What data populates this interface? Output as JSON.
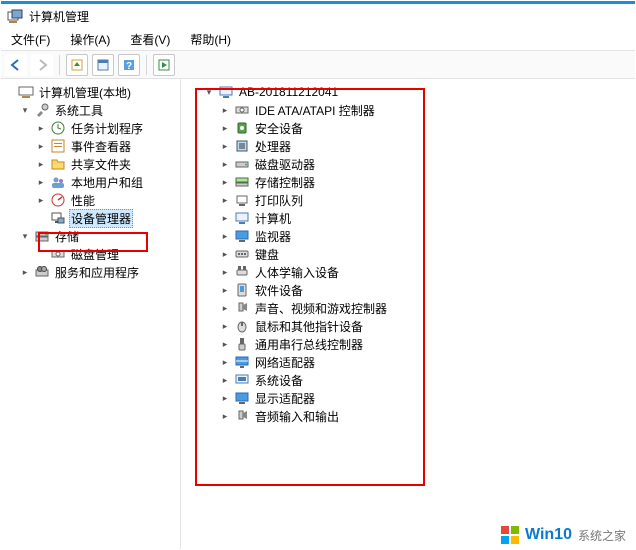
{
  "window": {
    "title": "计算机管理"
  },
  "menu": {
    "file": "文件(F)",
    "action": "操作(A)",
    "view": "查看(V)",
    "help": "帮助(H)"
  },
  "left_tree": {
    "root": "计算机管理(本地)",
    "system_tools": "系统工具",
    "task_scheduler": "任务计划程序",
    "event_viewer": "事件查看器",
    "shared_folders": "共享文件夹",
    "local_users": "本地用户和组",
    "performance": "性能",
    "device_manager": "设备管理器",
    "storage": "存储",
    "disk_management": "磁盘管理",
    "services_apps": "服务和应用程序"
  },
  "right_tree": {
    "computer_name": "AB-201811212041",
    "items": [
      "IDE ATA/ATAPI 控制器",
      "安全设备",
      "处理器",
      "磁盘驱动器",
      "存储控制器",
      "打印队列",
      "计算机",
      "监视器",
      "键盘",
      "人体学输入设备",
      "软件设备",
      "声音、视频和游戏控制器",
      "鼠标和其他指针设备",
      "通用串行总线控制器",
      "网络适配器",
      "系统设备",
      "显示适配器",
      "音频输入和输出"
    ]
  },
  "watermark": {
    "brand": "Win10",
    "sub": "系统之家"
  }
}
